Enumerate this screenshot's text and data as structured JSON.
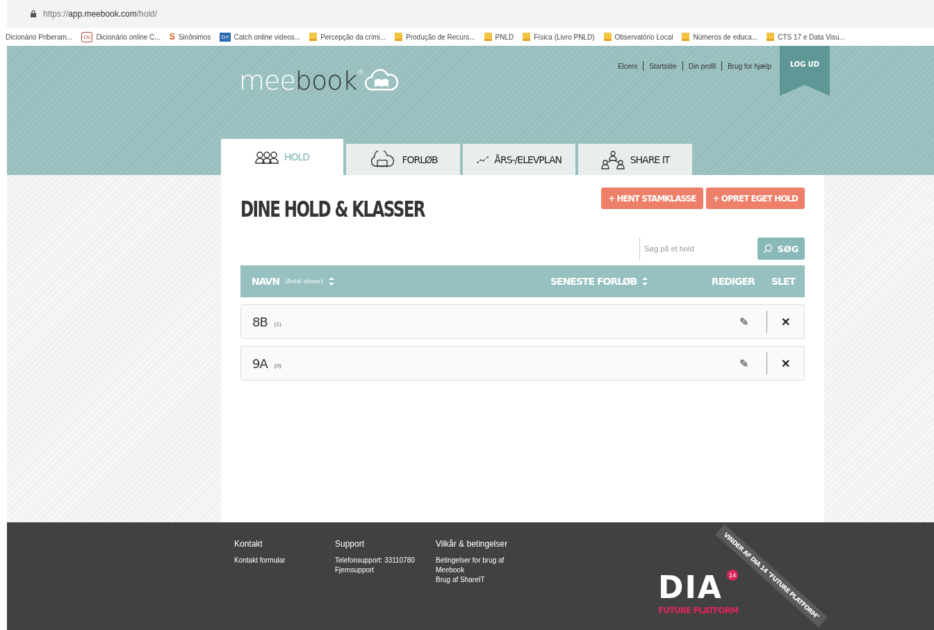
{
  "browser": {
    "url_prefix": "https://",
    "url_host": "app.meebook.com",
    "url_path": "/hold/",
    "bookmarks": [
      {
        "label": "Dicionário Priberam...",
        "kind": "plain"
      },
      {
        "label": "Dicionário online C...",
        "kind": "badge-outline",
        "badge": "Oc"
      },
      {
        "label": "Sinônimos",
        "kind": "badge-letter",
        "badge": "S"
      },
      {
        "label": "Catch online videos...",
        "kind": "badge-box",
        "badge": "DY"
      },
      {
        "label": "Percepção da crimi...",
        "kind": "folder"
      },
      {
        "label": "Produção de Recurs...",
        "kind": "folder"
      },
      {
        "label": "PNLD",
        "kind": "folder"
      },
      {
        "label": "Física (Livro PNLD)",
        "kind": "folder"
      },
      {
        "label": "Observatório Local",
        "kind": "folder"
      },
      {
        "label": "Números de educa...",
        "kind": "folder"
      },
      {
        "label": "CTS 17 e Data Visu...",
        "kind": "folder"
      }
    ]
  },
  "header": {
    "logo_light": "mee",
    "logo_dark": "book",
    "logo_mark": "®",
    "links": [
      "Elcero",
      "Startside",
      "Din profil",
      "Brug for hjælp"
    ],
    "logout": "LOG UD"
  },
  "tabs": [
    {
      "label": "HOLD",
      "kind": "people",
      "selected": true
    },
    {
      "label": "FORLØB",
      "kind": "cloud-book",
      "selected": false
    },
    {
      "label": "ÅRS-/ELEVPLAN",
      "kind": "graph",
      "selected": false
    },
    {
      "label": "SHARE IT",
      "kind": "share",
      "selected": false
    }
  ],
  "page": {
    "title": "DINE HOLD & KLASSER",
    "buttons": [
      "+ HENT STAMKLASSE",
      "+ OPRET EGET HOLD"
    ],
    "search": {
      "placeholder": "Søg på et hold",
      "button": "SØG"
    }
  },
  "table": {
    "columns": [
      {
        "label": "NAVN",
        "note": "(Antal elever)",
        "sortable": true
      },
      {
        "label": "SENESTE FORLØB",
        "sortable": true
      },
      {
        "label": "REDIGER"
      },
      {
        "label": "SLET"
      }
    ],
    "rows": [
      {
        "name": "8B",
        "count": "(1)",
        "edit": "✎",
        "delete": "✕"
      },
      {
        "name": "9A",
        "count": "(0)",
        "edit": "✎",
        "delete": "✕"
      }
    ]
  },
  "footer": {
    "columns": [
      {
        "heading": "Kontakt",
        "lines": [
          "Kontakt formular"
        ]
      },
      {
        "heading": "Support",
        "lines": [
          "Telefonsupport: 33110780",
          "Fjernsupport"
        ]
      },
      {
        "heading": "Vilkår & betingelser",
        "lines": [
          "Betingelser for brug af",
          "Meebook",
          "Brug af ShareIT"
        ]
      }
    ],
    "award": {
      "logo": "DIA",
      "badge": "14",
      "subtitle": "FUTURE PLATFORM",
      "ribbon": "VINDER AF DIA 14 \"FUTURE PLATFORM\""
    }
  }
}
